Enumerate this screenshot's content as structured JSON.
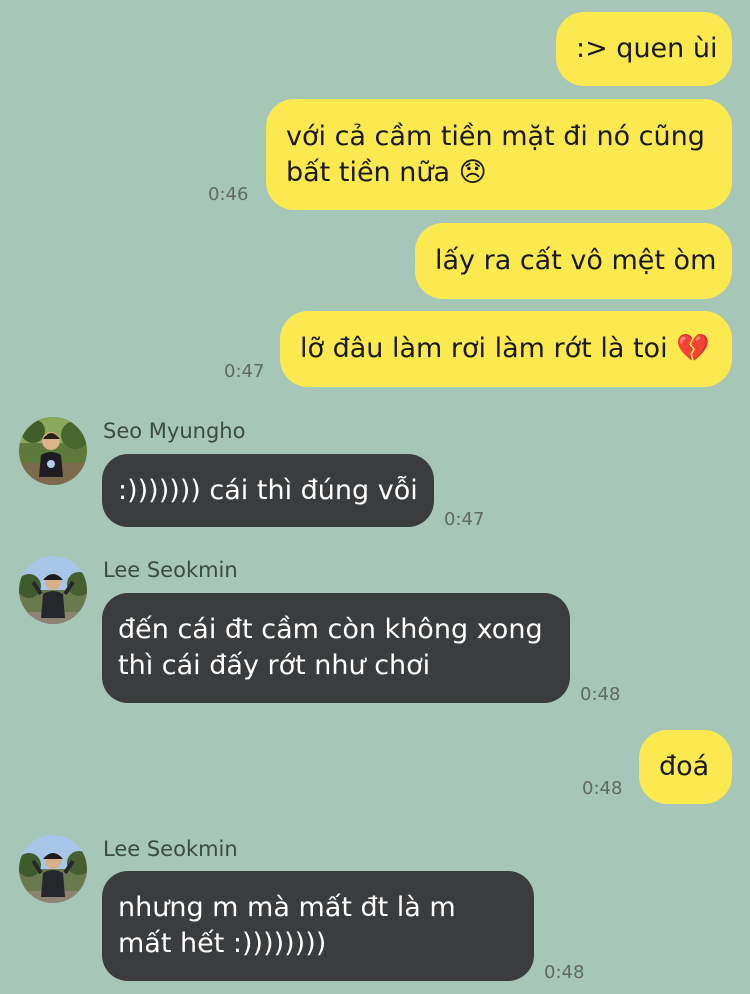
{
  "messages": [
    {
      "text": ":> quen ùi"
    },
    {
      "text": "với cả cầm tiền mặt đi nó cũng bất tiền nữa 😞",
      "time": "0:46"
    },
    {
      "text": "lấy ra cất vô mệt òm"
    },
    {
      "text": "lỡ đâu làm rơi làm rớt là toi 💔",
      "time": "0:47"
    },
    {
      "sender": "Seo Myungho",
      "avatar": "profile-photo",
      "text": ":))))))) cái thì đúng vỗi",
      "time": "0:47"
    },
    {
      "sender": "Lee Seokmin",
      "avatar": "profile-photo",
      "text": "đến cái đt cầm còn không xong thì cái đấy rớt như chơi",
      "time": "0:48"
    },
    {
      "text": "đoá",
      "time": "0:48"
    },
    {
      "sender": "Lee Seokmin",
      "avatar": "profile-photo",
      "text": "nhưng m mà mất đt là m mất hết :))))))))",
      "time": "0:48"
    }
  ],
  "colors": {
    "background": "#a6c6b8",
    "outgoing_bubble": "#fbe94f",
    "incoming_bubble": "#3a3c3e"
  }
}
